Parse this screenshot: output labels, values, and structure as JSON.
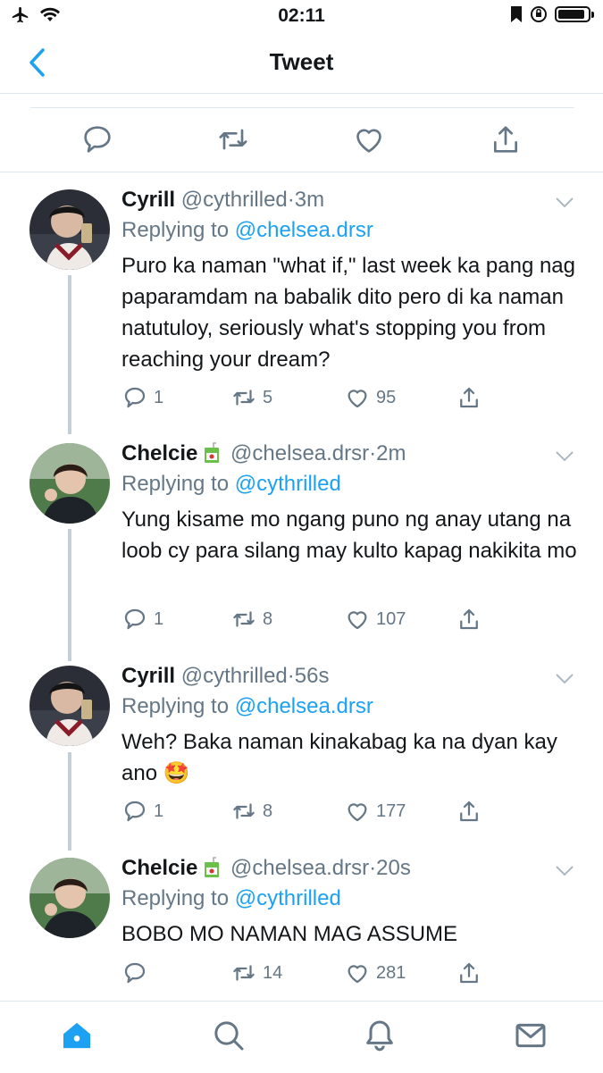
{
  "status_bar": {
    "time": "02:11",
    "left_icons": [
      "airplane-icon",
      "wifi-icon"
    ],
    "right_icons": [
      "bookmark-icon",
      "orientation-lock-icon",
      "battery-icon"
    ],
    "battery_level": 0.8
  },
  "nav": {
    "title": "Tweet",
    "back_icon": "chevron-left-icon"
  },
  "colors": {
    "link": "#1da1f2",
    "muted": "#657786",
    "text": "#14171a",
    "divider": "#e1e8ed"
  },
  "main_tweet_actions": [
    "reply-icon",
    "retweet-icon",
    "like-icon",
    "share-icon"
  ],
  "replies": [
    {
      "name": "Cyrill",
      "handle": "@cythrilled",
      "time": "3m",
      "replying_label": "Replying to",
      "replying_to": "@chelsea.drsr",
      "text": "Puro ka naman \"what if,\" last week ka pang nag paparamdam na babalik dito pero di ka naman natutuloy, seriously what's stopping you from reaching your dream?",
      "replies": "1",
      "retweets": "5",
      "likes": "95"
    },
    {
      "name": "Chelcie",
      "handle": "@chelsea.drsr",
      "time": "2m",
      "replying_label": "Replying to",
      "replying_to": "@cythrilled",
      "text": "Yung kisame mo ngang puno ng anay utang na loob cy para silang may kulto kapag nakikita mo",
      "replies": "1",
      "retweets": "8",
      "likes": "107"
    },
    {
      "name": "Cyrill",
      "handle": "@cythrilled",
      "time": "56s",
      "replying_label": "Replying to",
      "replying_to": "@chelsea.drsr",
      "text": "Weh? Baka naman kinakabag ka na dyan kay ano 🤩",
      "replies": "1",
      "retweets": "8",
      "likes": "177"
    },
    {
      "name": "Chelcie",
      "handle": "@chelsea.drsr",
      "time": "20s",
      "replying_label": "Replying to",
      "replying_to": "@cythrilled",
      "text": "BOBO MO NAMAN MAG ASSUME",
      "replies": "",
      "retweets": "14",
      "likes": "281"
    }
  ],
  "separator": "·",
  "tab_bar": [
    "home-icon",
    "search-icon",
    "notifications-icon",
    "messages-icon"
  ]
}
